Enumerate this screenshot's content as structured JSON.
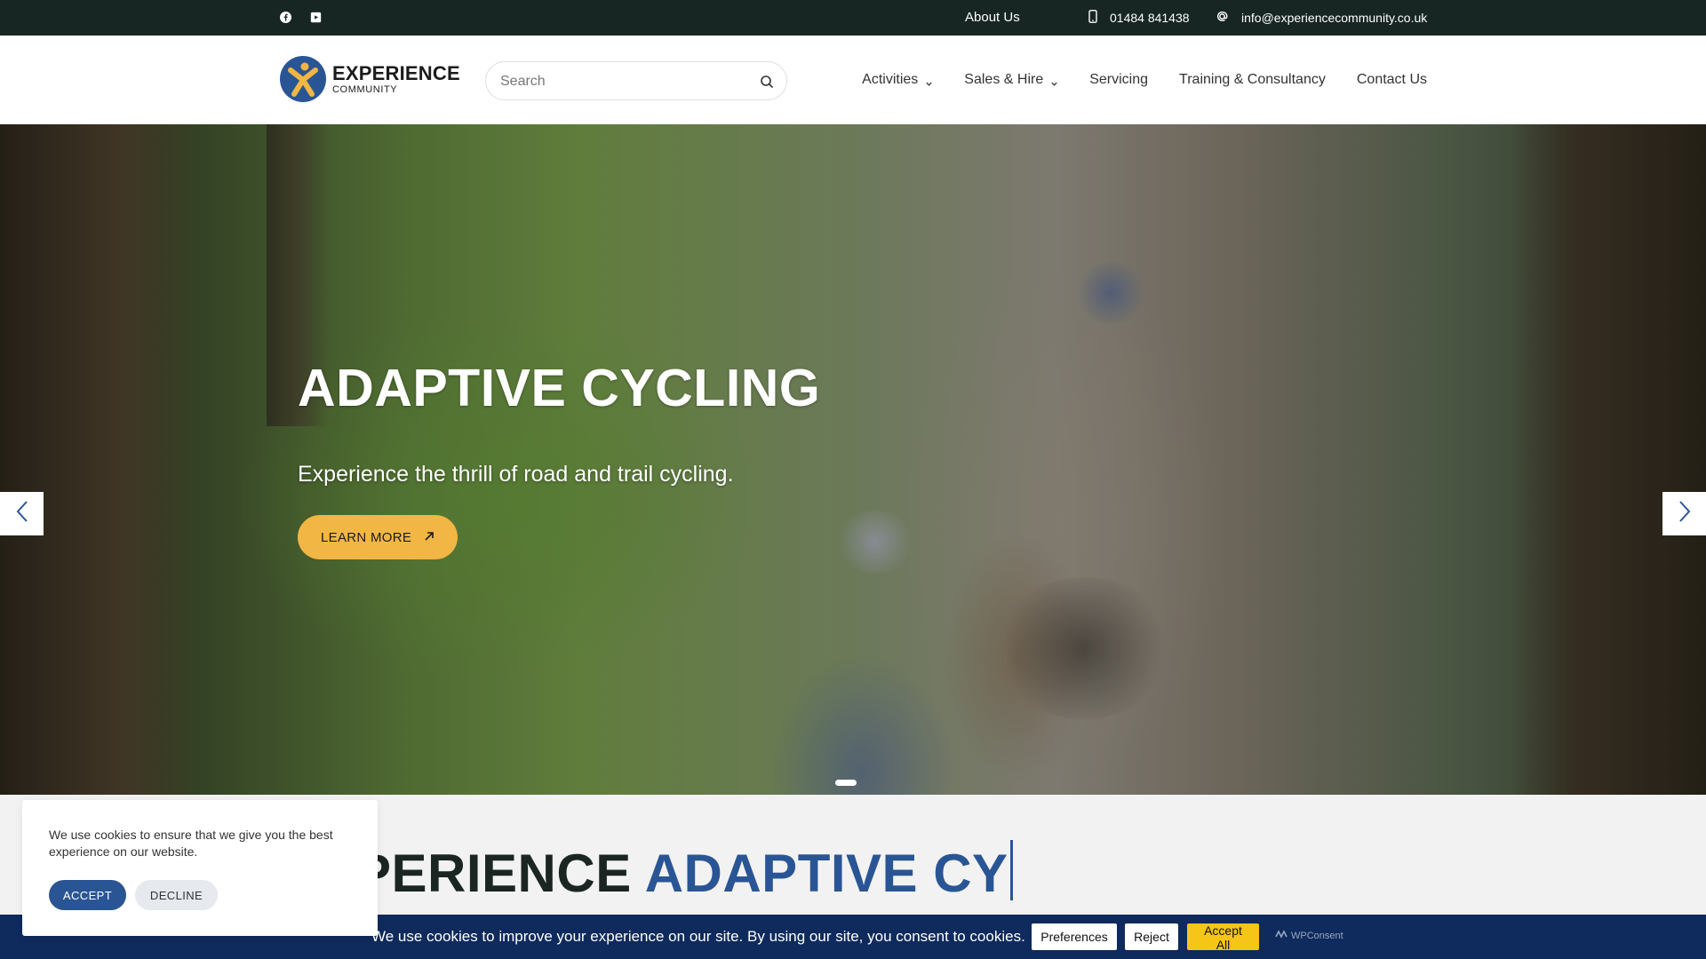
{
  "topbar": {
    "social": [
      {
        "name": "facebook-icon"
      },
      {
        "name": "youtube-icon"
      }
    ],
    "about_label": "About Us",
    "phone": "01484 841438",
    "email": "info@experiencecommunity.co.uk"
  },
  "header": {
    "logo_main": "EXPERIENCE",
    "logo_sub": "COMMUNITY",
    "search_placeholder": "Search",
    "nav": [
      {
        "label": "Activities",
        "dropdown": true
      },
      {
        "label": "Sales & Hire",
        "dropdown": true
      },
      {
        "label": "Servicing",
        "dropdown": false
      },
      {
        "label": "Training & Consultancy",
        "dropdown": false
      },
      {
        "label": "Contact Us",
        "dropdown": false
      }
    ]
  },
  "hero": {
    "title": "ADAPTIVE CYCLING",
    "subtitle": "Experience the thrill of road and trail cycling.",
    "cta_label": "LEARN MORE",
    "active_slide": 1,
    "slide_count": 1
  },
  "section": {
    "title_dark": "PERIENCE ",
    "title_blue": "ADAPTIVE CY"
  },
  "cookie_popup": {
    "message": "We use cookies to ensure that we give you the best experience on our website.",
    "accept_label": "ACCEPT",
    "decline_label": "DECLINE"
  },
  "consent_bar": {
    "message": "We use cookies to improve your experience on our site. By using our site, you consent to cookies.",
    "preferences_label": "Preferences",
    "reject_label": "Reject",
    "accept_all_label": "Accept All",
    "brand": "WPConsent"
  },
  "colors": {
    "topbar_bg": "#172623",
    "accent_yellow": "#f1b643",
    "brand_blue": "#2a5595",
    "consent_bg": "#0f2a5c",
    "accept_all_bg": "#f5c518"
  }
}
